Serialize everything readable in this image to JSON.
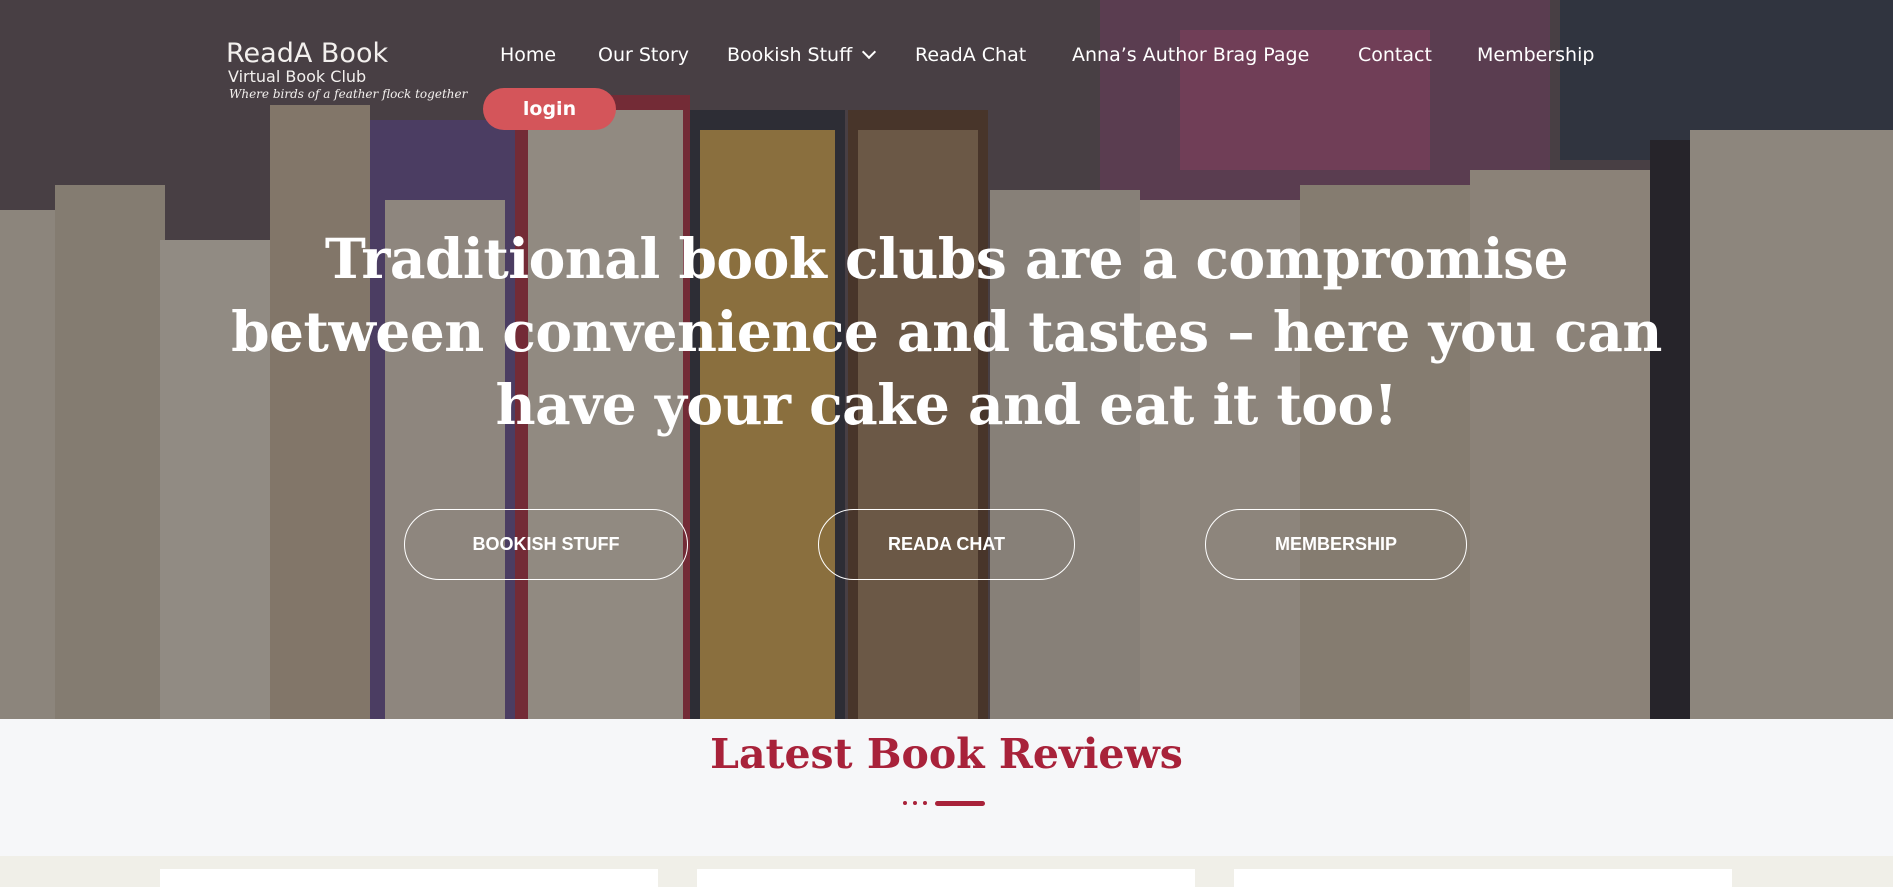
{
  "logo": {
    "name": "ReadA Book",
    "subtitle": "Virtual Book Club",
    "tagline": "Where birds of a feather flock together"
  },
  "nav": {
    "items": [
      {
        "label": "Home"
      },
      {
        "label": "Our Story"
      },
      {
        "label": "Bookish Stuff",
        "has_dropdown": true
      },
      {
        "label": "ReadA Chat"
      },
      {
        "label": "Anna’s Author Brag Page"
      },
      {
        "label": "Contact"
      },
      {
        "label": "Membership"
      }
    ],
    "login_label": "login"
  },
  "hero": {
    "headline": "Traditional book clubs are a compromise between convenience and tastes – here you can have your cake and eat it too!",
    "buttons": [
      {
        "label": "BOOKISH STUFF"
      },
      {
        "label": "READA CHAT"
      },
      {
        "label": "MEMBERSHIP"
      }
    ]
  },
  "reviews": {
    "title": "Latest Book Reviews"
  },
  "colors": {
    "accent": "#a8223a",
    "login_button": "#d4555a",
    "section_bg": "#f6f7f9"
  }
}
